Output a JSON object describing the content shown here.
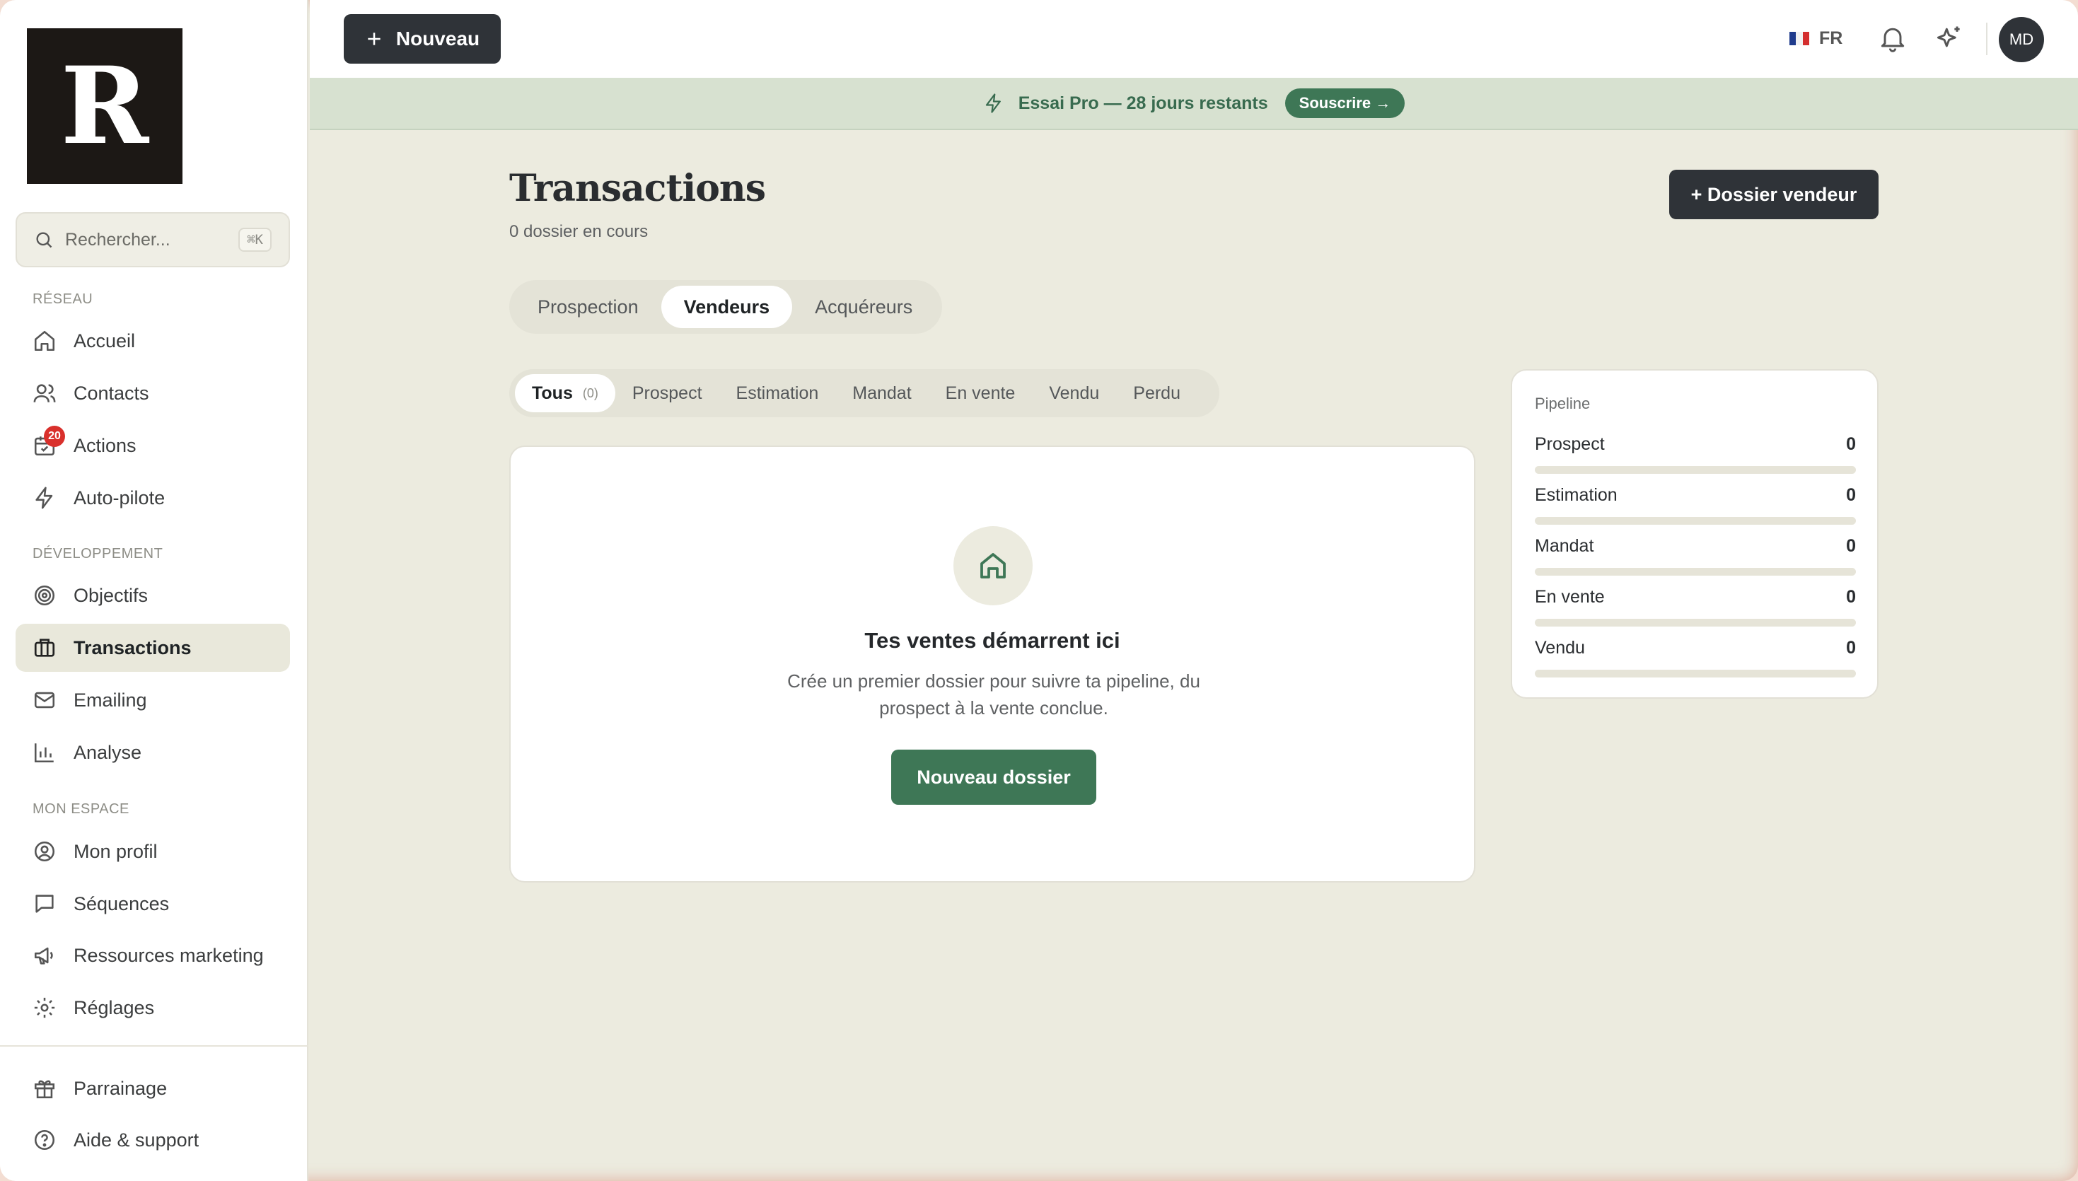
{
  "brand": {
    "logo_letter": "R"
  },
  "search": {
    "placeholder": "Rechercher...",
    "shortcut": "⌘K"
  },
  "sidebar": {
    "sections": [
      {
        "label": "RÉSEAU"
      },
      {
        "label": "DÉVELOPPEMENT"
      },
      {
        "label": "MON ESPACE"
      }
    ],
    "items": [
      {
        "label": "Accueil",
        "icon": "home-icon"
      },
      {
        "label": "Contacts",
        "icon": "users-icon"
      },
      {
        "label": "Actions",
        "icon": "calendar-check-icon",
        "badge": "20"
      },
      {
        "label": "Auto-pilote",
        "icon": "bolt-icon"
      },
      {
        "label": "Objectifs",
        "icon": "target-icon"
      },
      {
        "label": "Transactions",
        "icon": "briefcase-icon",
        "active": true
      },
      {
        "label": "Emailing",
        "icon": "mail-icon"
      },
      {
        "label": "Analyse",
        "icon": "bar-chart-icon"
      },
      {
        "label": "Mon profil",
        "icon": "user-circle-icon"
      },
      {
        "label": "Séquences",
        "icon": "message-icon"
      },
      {
        "label": "Ressources marketing",
        "icon": "megaphone-icon"
      },
      {
        "label": "Réglages",
        "icon": "gear-icon"
      },
      {
        "label": "Parrainage",
        "icon": "gift-icon"
      },
      {
        "label": "Aide & support",
        "icon": "help-icon"
      }
    ]
  },
  "topbar": {
    "new_label": "Nouveau",
    "lang": "FR",
    "avatar_initials": "MD"
  },
  "banner": {
    "text": "Essai Pro — 28 jours restants",
    "button": "Souscrire →"
  },
  "page": {
    "title": "Transactions",
    "subtitle": "0 dossier en cours",
    "primary_button": "+ Dossier vendeur"
  },
  "tabs": [
    {
      "label": "Prospection",
      "active": false
    },
    {
      "label": "Vendeurs",
      "active": true
    },
    {
      "label": "Acquéreurs",
      "active": false
    }
  ],
  "filters": [
    {
      "label": "Tous",
      "count": "(0)",
      "active": true
    },
    {
      "label": "Prospect"
    },
    {
      "label": "Estimation"
    },
    {
      "label": "Mandat"
    },
    {
      "label": "En vente"
    },
    {
      "label": "Vendu"
    },
    {
      "label": "Perdu"
    }
  ],
  "empty_state": {
    "title": "Tes ventes démarrent ici",
    "text": "Crée un premier dossier pour suivre ta pipeline, du prospect à la vente conclue.",
    "button": "Nouveau dossier"
  },
  "pipeline": {
    "label": "Pipeline",
    "stages": [
      {
        "label": "Prospect",
        "value": "0",
        "progress": 0
      },
      {
        "label": "Estimation",
        "value": "0",
        "progress": 0
      },
      {
        "label": "Mandat",
        "value": "0",
        "progress": 0
      },
      {
        "label": "En vente",
        "value": "0",
        "progress": 0
      },
      {
        "label": "Vendu",
        "value": "0",
        "progress": 0
      }
    ]
  },
  "colors": {
    "accent_green": "#3e7756",
    "dark_button": "#2f3338",
    "badge_red": "#d9302c",
    "background": "#ecebdf"
  }
}
